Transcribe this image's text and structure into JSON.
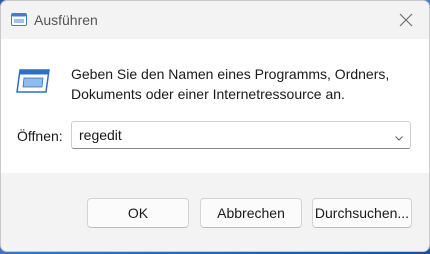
{
  "window": {
    "title": "Ausführen",
    "close_icon": "close-icon",
    "title_icon": "run-icon"
  },
  "main": {
    "description": "Geben Sie den Namen eines Programms, Ordners, Dokuments oder einer Internetressource an.",
    "icon": "run-icon",
    "open_label": "Öffnen:",
    "input_value": "regedit",
    "dropdown_icon": "chevron-down-icon"
  },
  "buttons": {
    "ok": "OK",
    "cancel": "Abbrechen",
    "browse": "Durchsuchen..."
  },
  "colors": {
    "accent": "#3a7fd5",
    "dialog_bg": "#f3f3f3",
    "content_bg": "#ffffff"
  }
}
